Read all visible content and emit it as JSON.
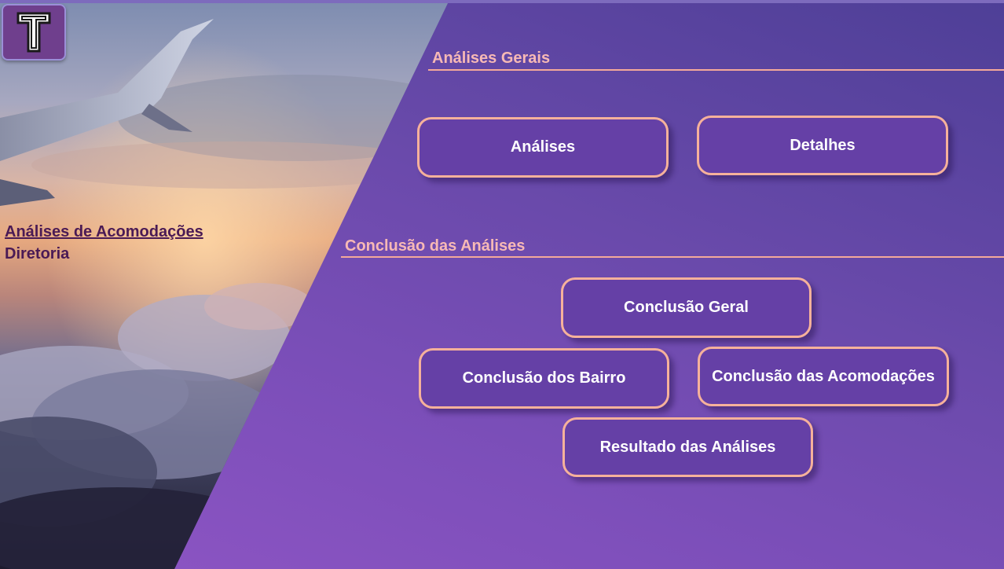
{
  "logo": {
    "letter": "T",
    "icon": "letter-t-logo-icon"
  },
  "left": {
    "title": "Análises de Acomodações",
    "subtitle": "Diretoria"
  },
  "sections": {
    "general": {
      "title": "Análises Gerais"
    },
    "conclusion": {
      "title": "Conclusão das Análises"
    }
  },
  "buttons": {
    "analises": "Análises",
    "detalhes": "Detalhes",
    "conclusao_geral": "Conclusão Geral",
    "conclusao_bairro": "Conclusão dos Bairro",
    "conclusao_acomodacoes": "Conclusão das Acomodações",
    "resultado": "Resultado das Análises"
  },
  "colors": {
    "accent": "#f6b19b",
    "button_bg": "#6540a6",
    "panel_start": "#4e3f97",
    "panel_end": "#8e55c4",
    "title_text": "#4a1a55"
  }
}
